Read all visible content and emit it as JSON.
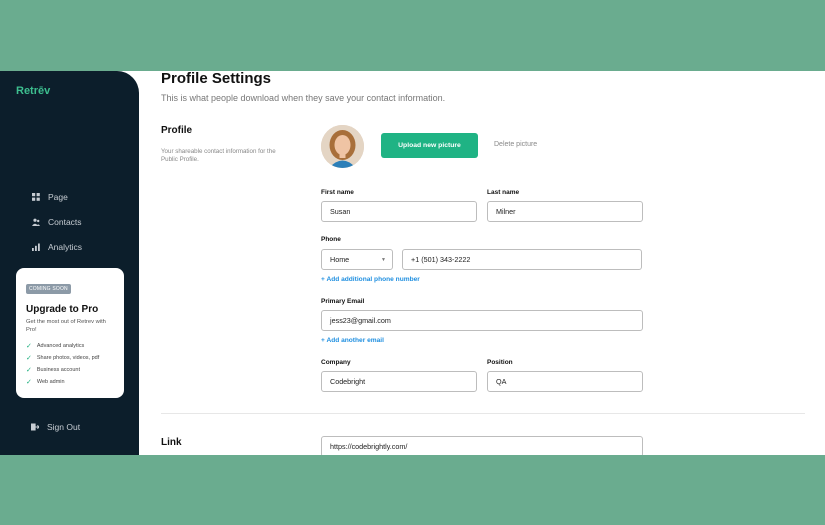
{
  "app": {
    "logo": "Retrēv"
  },
  "sidebar": {
    "items": [
      {
        "label": "Page",
        "icon": "grid-icon"
      },
      {
        "label": "Contacts",
        "icon": "people-icon"
      },
      {
        "label": "Analytics",
        "icon": "bar-chart-icon"
      }
    ],
    "promo": {
      "badge": "COMING SOON",
      "title": "Upgrade to Pro",
      "description": "Get the most out of Retrev with Pro!",
      "features": [
        "Advanced analytics",
        "Share photos, videos, pdf",
        "Business account",
        "Web admin"
      ]
    },
    "signout_label": "Sign Out"
  },
  "main": {
    "title": "Profile Settings",
    "subtitle": "This is what people download when they save your contact information.",
    "profile_section": {
      "label": "Profile",
      "description": "Your shareable contact information for the Public Profile.",
      "upload_label": "Upload new picture",
      "delete_label": "Delete picture"
    },
    "fields": {
      "first_name": {
        "label": "First name",
        "value": "Susan"
      },
      "last_name": {
        "label": "Last name",
        "value": "Milner"
      },
      "phone": {
        "label": "Phone",
        "type": "Home",
        "value": "+1 (501) 343-2222"
      },
      "add_phone": "+ Add additional phone number",
      "email": {
        "label": "Primary Email",
        "value": "jess23@gmail.com"
      },
      "add_email": "+ Add another email",
      "company": {
        "label": "Company",
        "value": "Codebright"
      },
      "position": {
        "label": "Position",
        "value": "QA"
      }
    },
    "link_section": {
      "label": "Link",
      "value": "https://codebrightly.com/"
    }
  },
  "colors": {
    "accent": "#1fb384",
    "sidebar": "#0c1e2b",
    "background": "#6aac8f",
    "link": "#1f8fe0"
  }
}
